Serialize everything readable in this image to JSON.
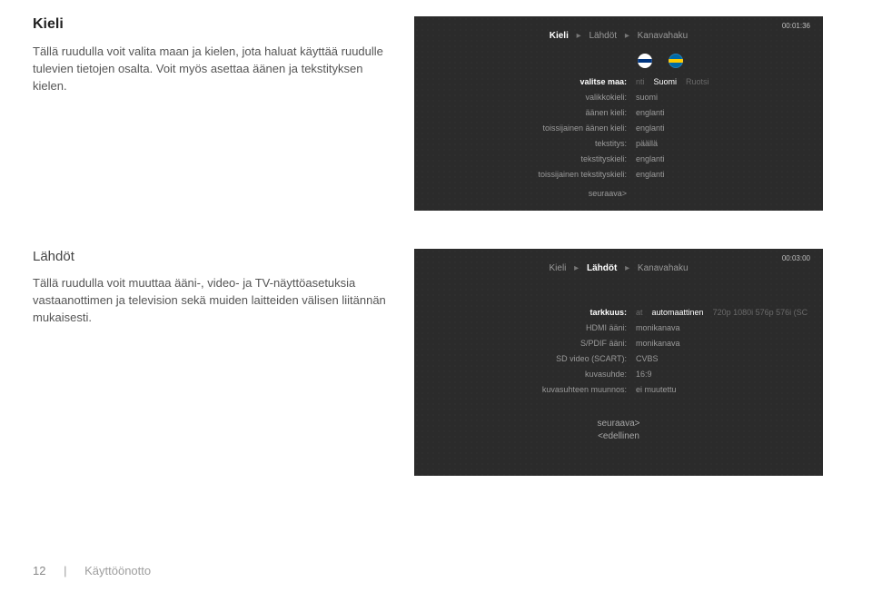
{
  "section1": {
    "title": "Kieli",
    "body": "Tällä ruudulla voit valita maan ja kielen, jota haluat käyttää ruudulle tulevien tietojen osalta. Voit myös asettaa äänen ja tekstityksen kielen.",
    "screen": {
      "time": "00:01:36",
      "crumb": {
        "a": "Kieli",
        "b": "Lähdöt",
        "c": "Kanavahaku"
      },
      "flags": {
        "left": "fi",
        "right": "se"
      },
      "rows": [
        {
          "label": "valitse maa:",
          "opts_pre": "nti",
          "value": "Suomi",
          "opts_post": "Ruotsi",
          "selected": true
        },
        {
          "label": "valikkokieli:",
          "value": "suomi"
        },
        {
          "label": "äänen kieli:",
          "value": "englanti"
        },
        {
          "label": "toissijainen äänen kieli:",
          "value": "englanti"
        },
        {
          "label": "tekstitys:",
          "value": "päällä"
        },
        {
          "label": "tekstityskieli:",
          "value": "englanti"
        },
        {
          "label": "toissijainen tekstityskieli:",
          "value": "englanti"
        }
      ],
      "next": "seuraava>"
    }
  },
  "section2": {
    "title": "Lähdöt",
    "body": "Tällä ruudulla voit muuttaa ääni-, video- ja TV-näyttöasetuksia vastaanottimen ja television sekä muiden laitteiden välisen liitännän mukaisesti.",
    "screen": {
      "time": "00:03:00",
      "crumb": {
        "a": "Kieli",
        "b": "Lähdöt",
        "c": "Kanavahaku"
      },
      "rows": [
        {
          "label": "tarkkuus:",
          "opts_pre": "at",
          "value": "automaattinen",
          "opts_post": "720p 1080i 576p 576i (SC",
          "selected": true
        },
        {
          "label": "HDMI ääni:",
          "value": "monikanava"
        },
        {
          "label": "S/PDIF ääni:",
          "value": "monikanava"
        },
        {
          "label": "SD video (SCART):",
          "value": "CVBS"
        },
        {
          "label": "kuvasuhde:",
          "value": "16:9"
        },
        {
          "label": "kuvasuhteen muunnos:",
          "value": "ei muutettu"
        }
      ],
      "next": "seuraava>",
      "prev": "<edellinen"
    }
  },
  "footer": {
    "page": "12",
    "sep": "|",
    "chapter": "Käyttöönotto"
  }
}
